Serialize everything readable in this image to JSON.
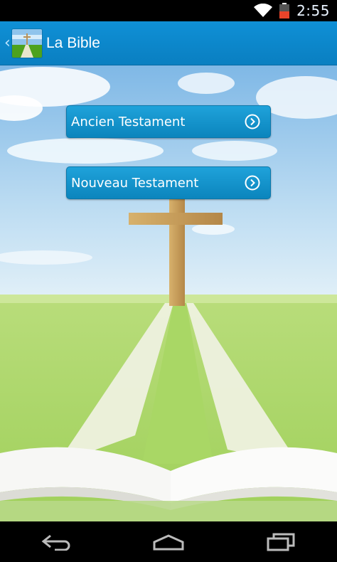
{
  "status_bar": {
    "time": "2:55",
    "icons": [
      "wifi-icon",
      "battery-icon"
    ],
    "battery_color": "#e8442a"
  },
  "action_bar": {
    "title": "La Bible",
    "icon": "app-icon",
    "background": "#0a84c6"
  },
  "menu": {
    "items": [
      {
        "label": "Ancien Testament",
        "icon": "chevron-right-circle-icon"
      },
      {
        "label": "Nouveau Testament",
        "icon": "chevron-right-circle-icon"
      }
    ]
  },
  "nav_bar": {
    "buttons": [
      "back-icon",
      "home-icon",
      "recent-apps-icon"
    ]
  }
}
